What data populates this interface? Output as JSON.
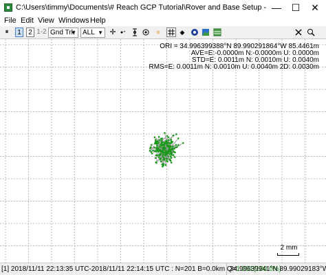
{
  "window": {
    "title": "C:\\Users\\timmy\\Documents\\# Reach GCP Tutorial\\Rover and Base Setup - RTKLib\\Rov...",
    "minimize_glyph": "—",
    "maximize_glyph": "☐",
    "close_glyph": "✕"
  },
  "menu": {
    "file": "File",
    "edit": "Edit",
    "view": "View",
    "windows": "Windows",
    "help": "Help"
  },
  "toolbar": {
    "pause_glyph": "⏸",
    "btn1": "1",
    "btn2": "2",
    "btn12": "1-2",
    "plot_type": "Gnd Trk",
    "quality": "ALL",
    "dropdown_arrow": "▼",
    "cross_glyph": "✛",
    "marker_glyph": "◆"
  },
  "plot": {
    "ori": "ORI = 34.996399388°N  89.990291864°W 85.4461m",
    "ave": "AVE=E:-0.0000m N:-0.0000m U: 0.0000m",
    "std": "STD=E: 0.0011m N: 0.0010m U: 0.0040m",
    "rms": "RMS=E: 0.0011m N: 0.0010m U: 0.0040m 2D: 0.0030m",
    "scale_label": "2 mm",
    "point_color": "#1a9a1a",
    "line_color": "#9a9a9a",
    "grid_color": "#b8b8b8"
  },
  "status": {
    "left_prefix": "[1] 2018/11/11 22:13:35 UTC-2018/11/11 22:14:15 UTC : N=201 B=0.0km Q=",
    "q_value": "1:201(100.0%)",
    "right": "34.99639941°N 89.99029183°W"
  }
}
